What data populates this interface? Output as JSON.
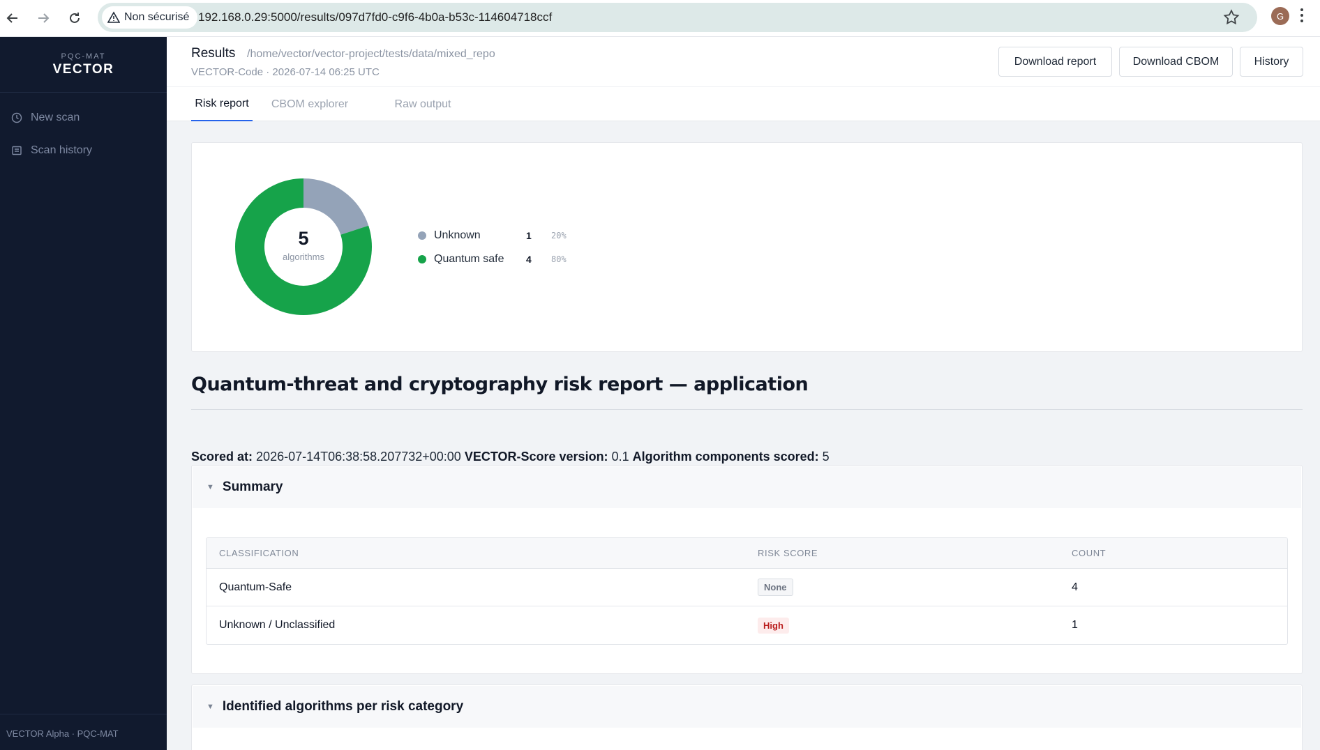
{
  "browser": {
    "security_label": "Non sécurisé",
    "url": "192.168.0.29:5000/results/097d7fd0-c9f6-4b0a-b53c-114604718ccf",
    "profile_initial": "G"
  },
  "sidebar": {
    "brand_sub": "PQC-MAT",
    "brand_name": "VECTOR",
    "items": [
      {
        "label": "New scan",
        "icon": "clock-icon"
      },
      {
        "label": "Scan history",
        "icon": "list-icon"
      }
    ],
    "footer": "VECTOR Alpha · PQC-MAT"
  },
  "header": {
    "title": "Results",
    "path": "/home/vector/vector-project/tests/data/mixed_repo",
    "meta": "VECTOR-Code  · 2026-07-14 06:25 UTC",
    "buttons": {
      "download_report": "Download report",
      "download_cbom": "Download CBOM",
      "history": "History"
    }
  },
  "tabs": [
    {
      "label": "Risk report",
      "active": true
    },
    {
      "label": "CBOM explorer",
      "active": false
    },
    {
      "label": "Raw output",
      "active": false
    }
  ],
  "donut": {
    "total": "5",
    "total_label": "algorithms",
    "segments": [
      {
        "name": "Unknown",
        "count": "1",
        "percent": "20%",
        "value": 1,
        "color": "#94a3b8"
      },
      {
        "name": "Quantum safe",
        "count": "4",
        "percent": "80%",
        "value": 4,
        "color": "#16a34a"
      }
    ]
  },
  "report": {
    "title": "Quantum-threat and cryptography risk report — application",
    "scored_at_label": "Scored at:",
    "scored_at_value": "2026-07-14T06:38:58.207732+00:00",
    "version_label": "VECTOR-Score version:",
    "version_value": "0.1",
    "components_label": "Algorithm components scored:",
    "components_value": "5"
  },
  "summary": {
    "heading": "Summary",
    "columns": [
      "CLASSIFICATION",
      "RISK SCORE",
      "COUNT"
    ],
    "rows": [
      {
        "classification": "Quantum-Safe",
        "risk": "None",
        "risk_level": "none",
        "count": "4"
      },
      {
        "classification": "Unknown / Unclassified",
        "risk": "High",
        "risk_level": "high",
        "count": "1"
      }
    ]
  },
  "identified": {
    "heading": "Identified algorithms per risk category"
  }
}
